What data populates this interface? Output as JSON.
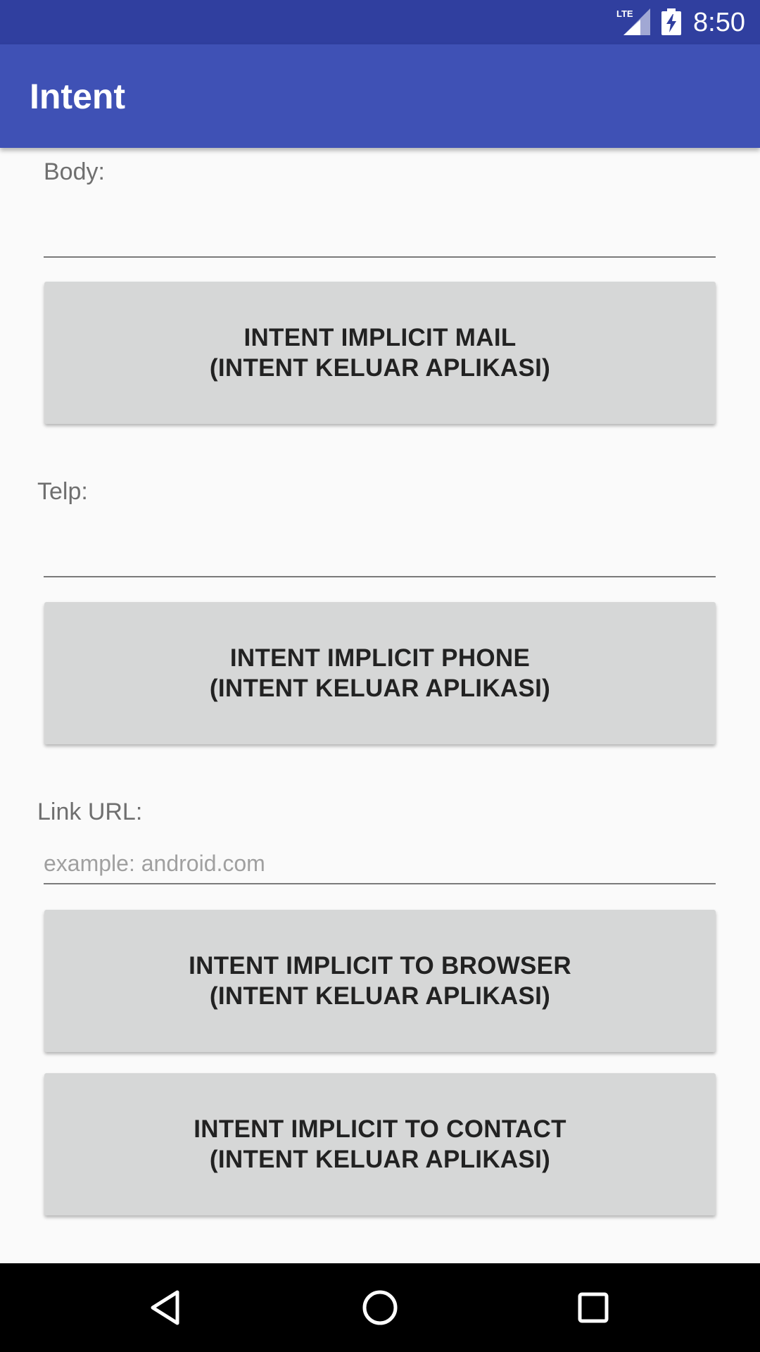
{
  "status_bar": {
    "network_label": "LTE",
    "time": "8:50",
    "icons": [
      "lte-signal-icon",
      "battery-charging-icon"
    ]
  },
  "app_bar": {
    "title": "Intent"
  },
  "form": {
    "body": {
      "label": "Body:",
      "value": "",
      "placeholder": ""
    },
    "mail_button": {
      "line1": "INTENT IMPLICIT MAIL",
      "line2": "(INTENT KELUAR APLIKASI)"
    },
    "telp": {
      "label": "Telp:",
      "value": "",
      "placeholder": ""
    },
    "phone_button": {
      "line1": "INTENT IMPLICIT PHONE",
      "line2": "(INTENT KELUAR APLIKASI)"
    },
    "link": {
      "label": "Link URL:",
      "value": "",
      "placeholder": "example: android.com"
    },
    "browser_button": {
      "line1": "INTENT IMPLICIT TO BROWSER",
      "line2": "(INTENT KELUAR APLIKASI)"
    },
    "contact_button": {
      "line1": "INTENT IMPLICIT TO CONTACT",
      "line2": "(INTENT KELUAR APLIKASI)"
    }
  },
  "nav_bar": {
    "icons": [
      "back-icon",
      "home-icon",
      "recents-icon"
    ]
  },
  "colors": {
    "status_bar": "#303f9f",
    "app_bar": "#3f51b5",
    "background": "#fafafa",
    "button": "#d6d7d7",
    "nav_bar": "#000000"
  }
}
